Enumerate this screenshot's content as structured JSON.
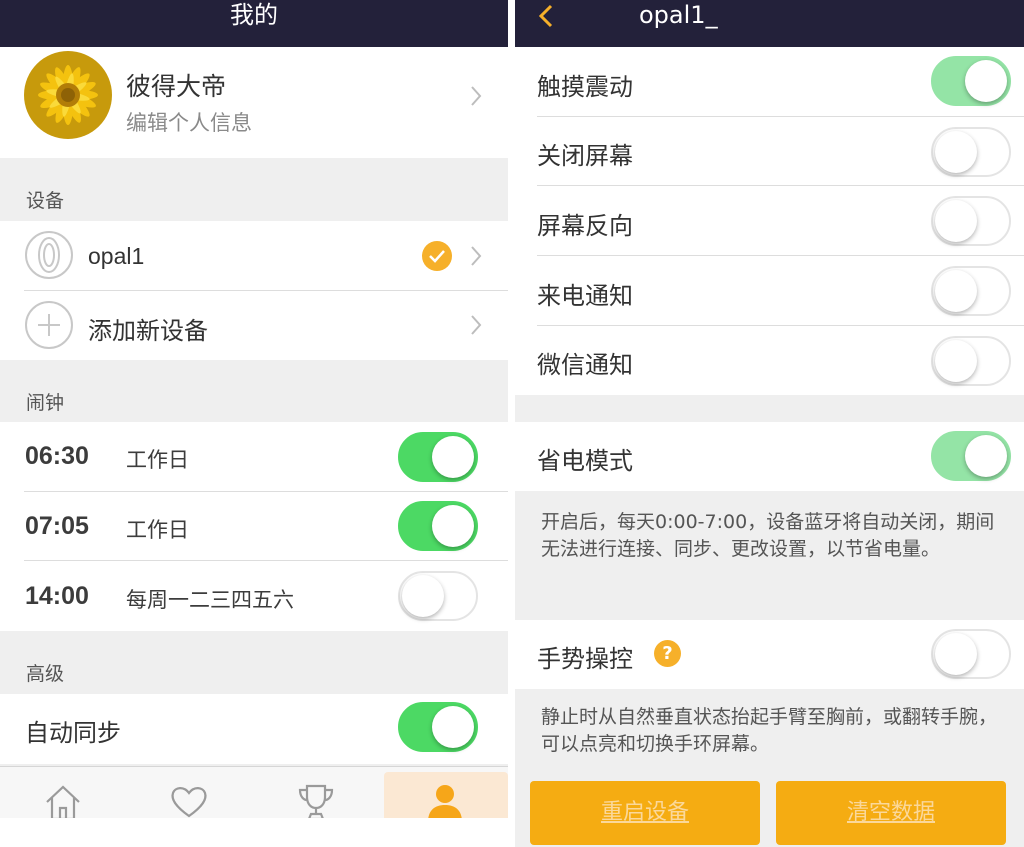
{
  "left": {
    "title": "我的",
    "profile": {
      "name": "彼得大帝",
      "subtitle": "编辑个人信息"
    },
    "devices": {
      "header": "设备",
      "device_name": "opal1",
      "add_label": "添加新设备"
    },
    "alarms": {
      "header": "闹钟",
      "items": [
        {
          "time": "06:30",
          "repeat": "工作日",
          "on": true
        },
        {
          "time": "07:05",
          "repeat": "工作日",
          "on": true
        },
        {
          "time": "14:00",
          "repeat": "每周一二三四五六",
          "on": false
        }
      ]
    },
    "advanced": {
      "header": "高级",
      "auto_sync": "自动同步",
      "auto_sync_on": true
    },
    "tabs": [
      "home-icon",
      "heart-icon",
      "trophy-icon",
      "person-icon"
    ],
    "active_tab": "person-icon"
  },
  "right": {
    "title": "opal1_",
    "settings": [
      {
        "label": "触摸震动",
        "on": true
      },
      {
        "label": "关闭屏幕",
        "on": false
      },
      {
        "label": "屏幕反向",
        "on": false
      },
      {
        "label": "来电通知",
        "on": false
      },
      {
        "label": "微信通知",
        "on": false
      }
    ],
    "power_save": {
      "label": "省电模式",
      "on": true,
      "note": "开启后，每天0:00-7:00，设备蓝牙将自动关闭，期间无法进行连接、同步、更改设置，以节省电量。"
    },
    "gesture": {
      "label": "手势操控",
      "help": "?",
      "on": false,
      "note": "静止时从自然垂直状态抬起手臂至胸前，或翻转手腕，可以点亮和切换手环屏幕。"
    },
    "buttons": {
      "restart": "重启设备",
      "clear": "清空数据"
    },
    "colors": {
      "nav": "#23213a",
      "accent": "#f5ac12",
      "toggle_on": "#4cd964"
    }
  }
}
